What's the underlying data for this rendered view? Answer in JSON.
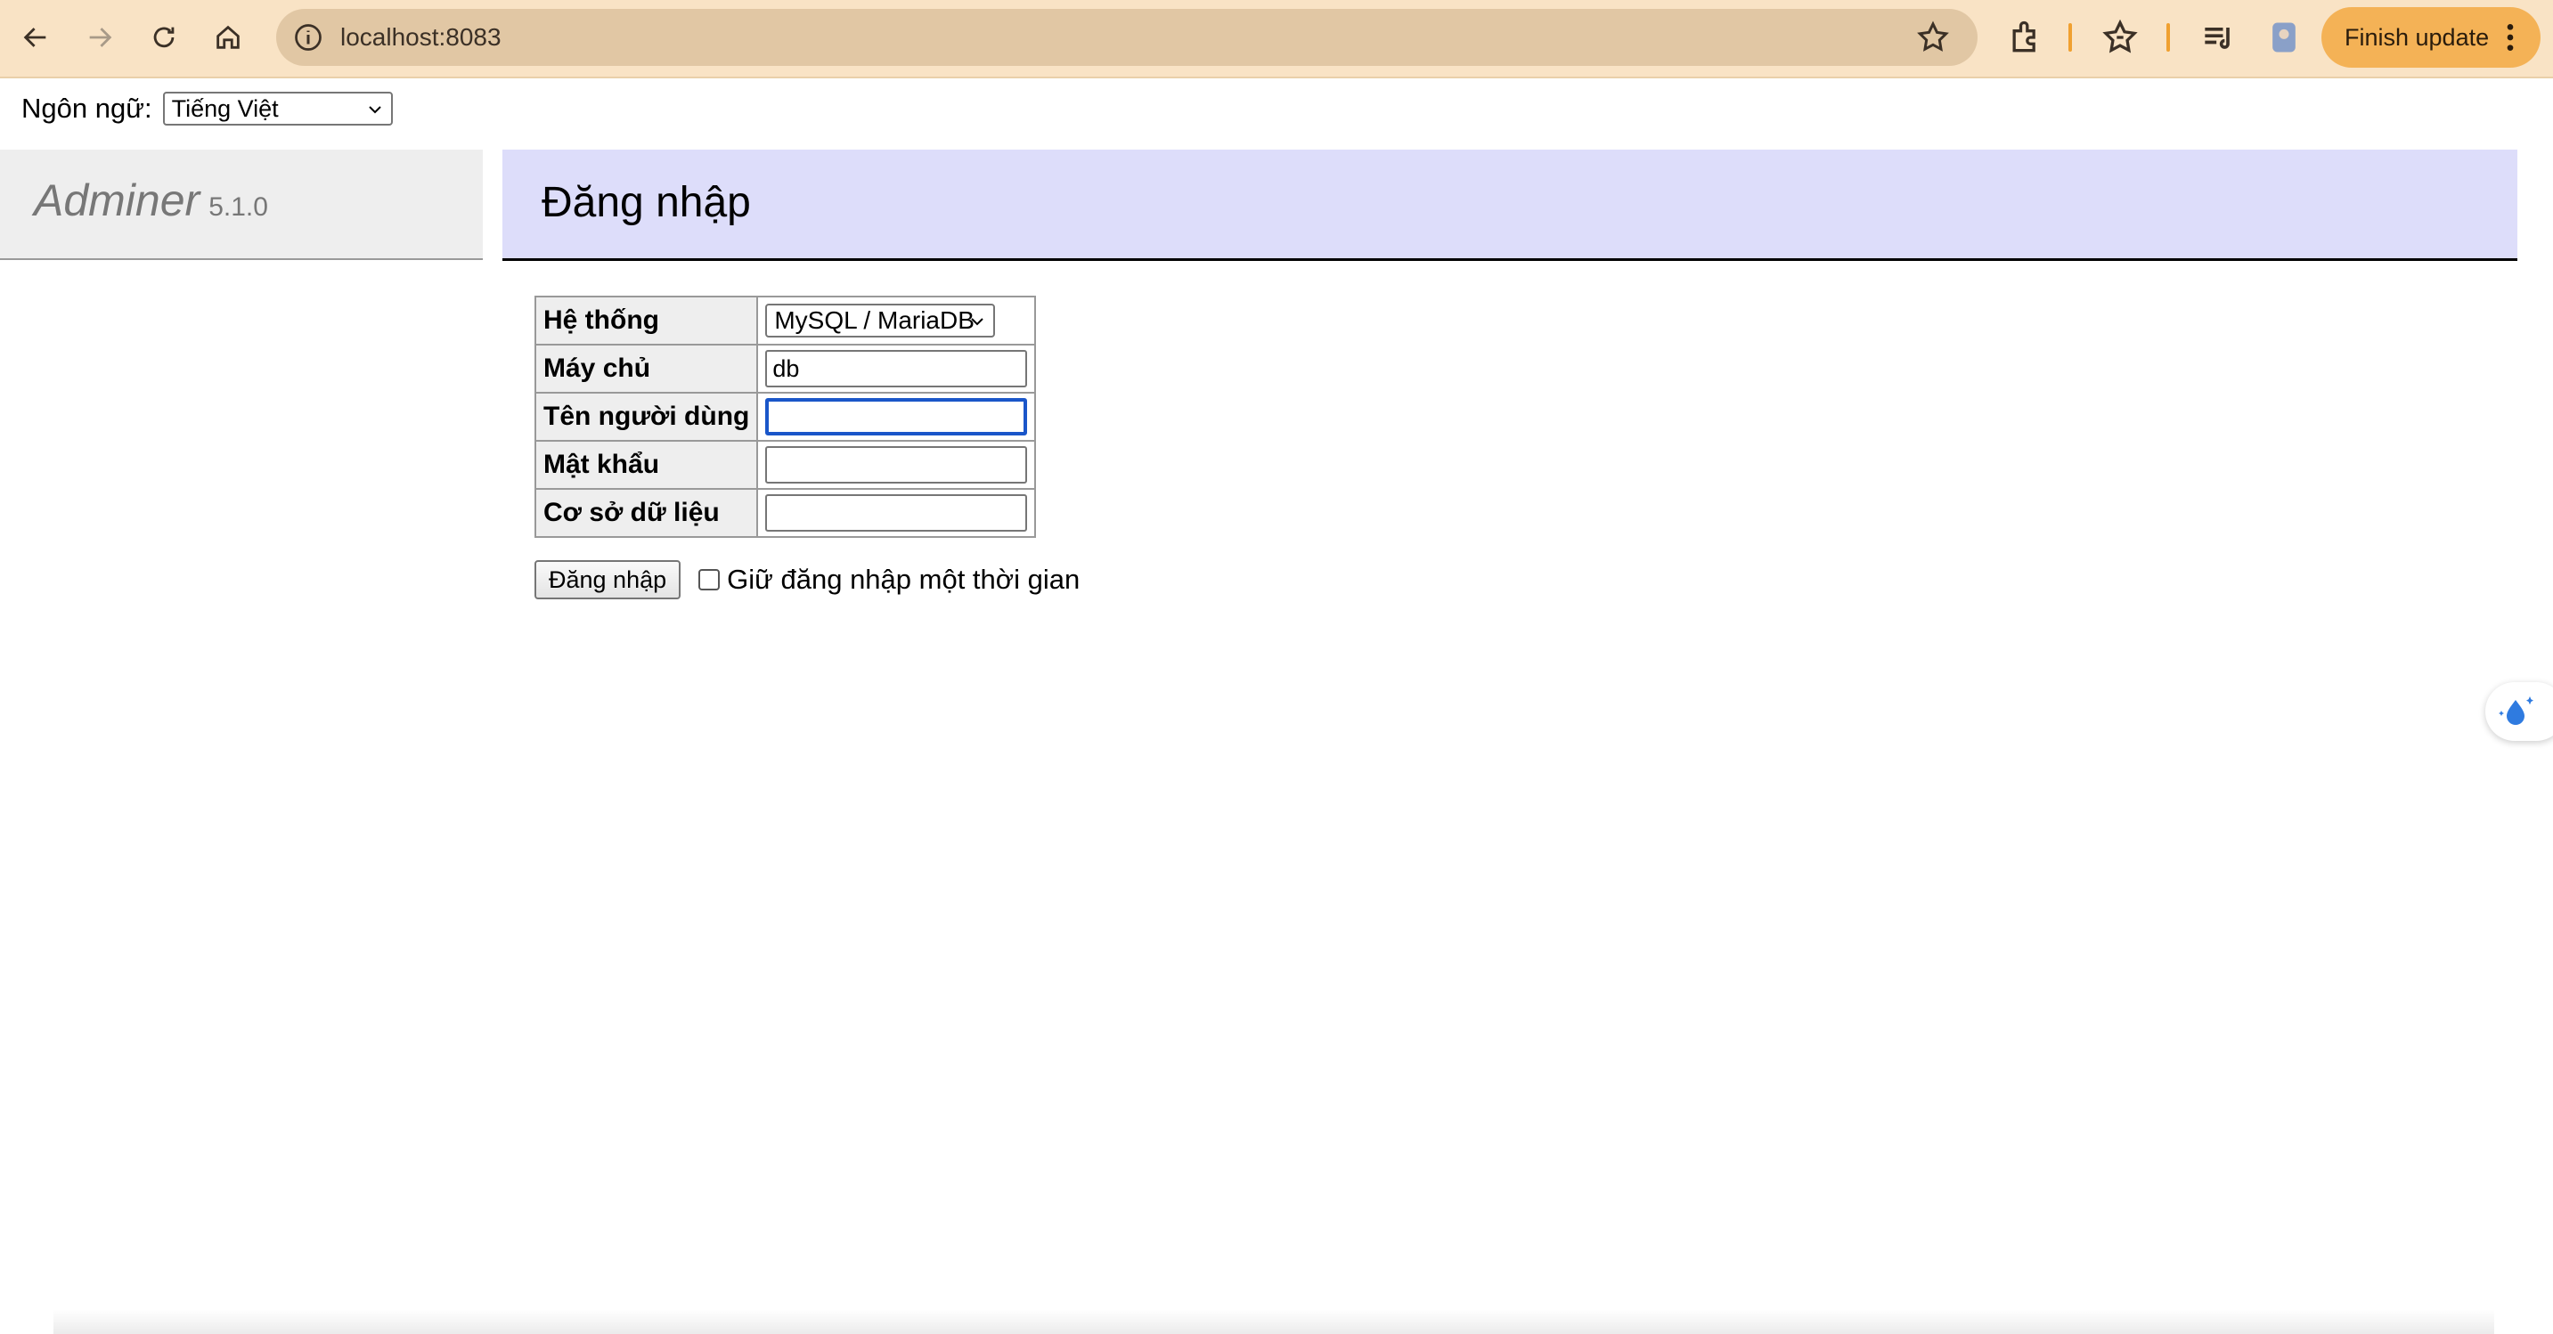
{
  "browser": {
    "url": "localhost:8083",
    "finish_update_label": "Finish update",
    "icons": [
      "back-icon",
      "forward-icon",
      "reload-icon",
      "home-icon",
      "site-info-icon",
      "bookmark-star-icon",
      "extensions-icon",
      "favorites-icon",
      "reading-list-icon",
      "profile-icon",
      "more-menu-icon"
    ],
    "accent_color": "#f4b256"
  },
  "language": {
    "label": "Ngôn ngữ:",
    "selected": "Tiếng Việt"
  },
  "sidebar": {
    "brand": "Adminer",
    "version": "5.1.0"
  },
  "page": {
    "title": "Đăng nhập"
  },
  "form": {
    "rows": [
      {
        "label": "Hệ thống",
        "value": "MySQL / MariaDB"
      },
      {
        "label": "Máy chủ",
        "value": "db"
      },
      {
        "label": "Tên người dùng",
        "value": ""
      },
      {
        "label": "Mật khẩu",
        "value": ""
      },
      {
        "label": "Cơ sở dữ liệu",
        "value": ""
      }
    ],
    "submit_label": "Đăng nhập",
    "remember_label": "Giữ đăng nhập một thời gian"
  }
}
